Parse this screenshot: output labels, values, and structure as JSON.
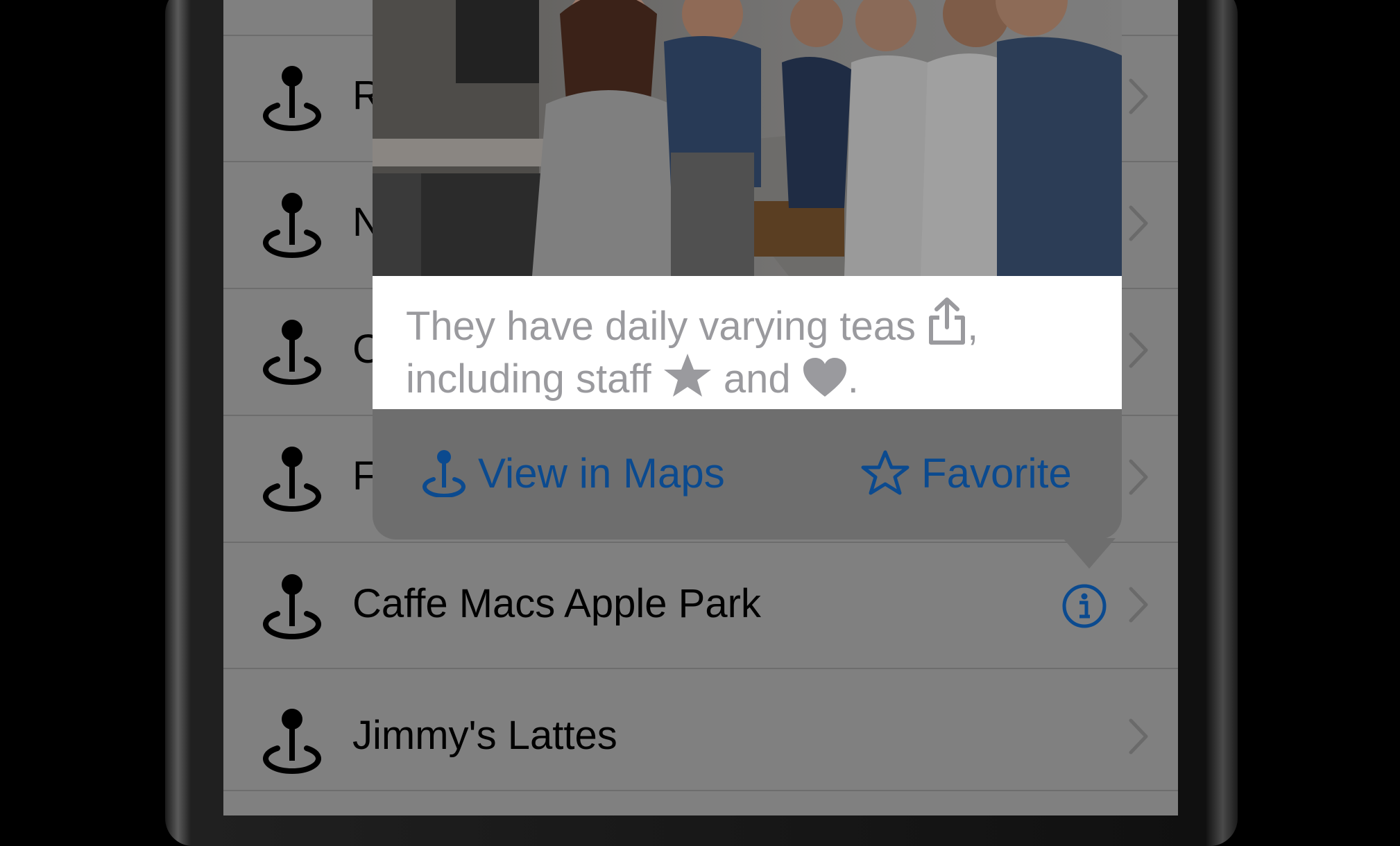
{
  "colors": {
    "accent": "#0b4a8f",
    "dim_overlay": "#808080",
    "caption_text": "#9a9a9e"
  },
  "list": {
    "rows": [
      {
        "label": "R",
        "icon": "map-pin-icon"
      },
      {
        "label": "N",
        "icon": "map-pin-icon"
      },
      {
        "label": "C",
        "icon": "map-pin-icon"
      },
      {
        "label": "F",
        "icon": "map-pin-icon"
      },
      {
        "label": "Caffe Macs Apple Park",
        "icon": "map-pin-icon",
        "has_info": true
      },
      {
        "label": "Jimmy's Lattes",
        "icon": "map-pin-icon"
      }
    ]
  },
  "popover": {
    "caption": {
      "part1": "They have daily varying teas ",
      "part2": ",",
      "part3": "including staff ",
      "part4": " and ",
      "part5": "."
    },
    "actions": {
      "view_in_maps": "View in Maps",
      "favorite": "Favorite"
    }
  }
}
